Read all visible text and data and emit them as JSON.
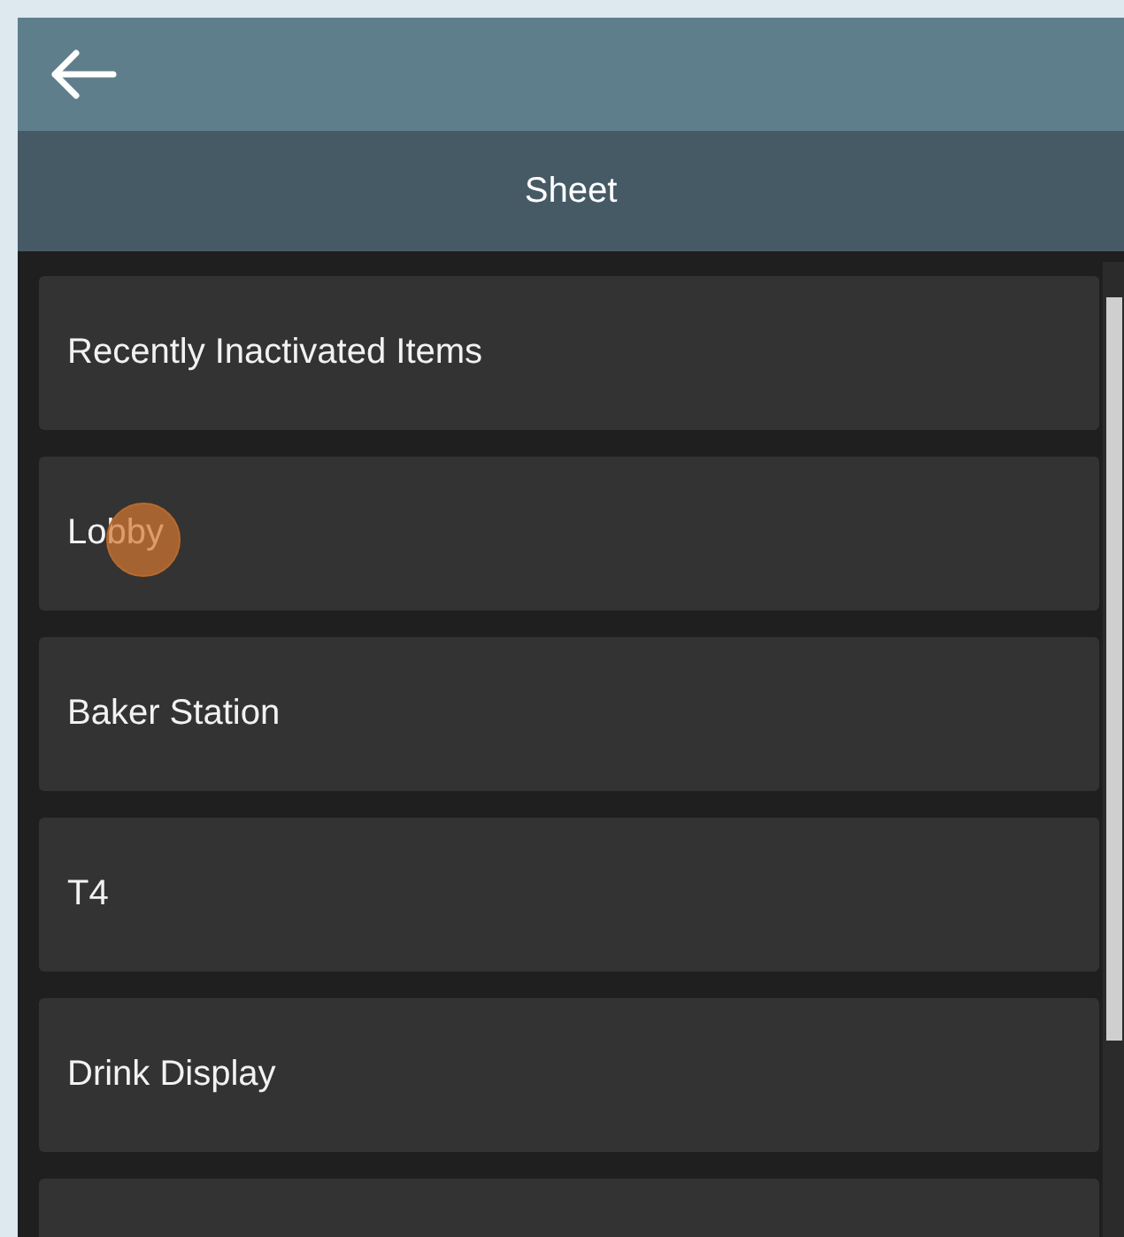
{
  "top_bar": {
    "back": true
  },
  "header": {
    "title": "Sheet"
  },
  "items": [
    {
      "label": "Recently Inactivated Items",
      "touched": false
    },
    {
      "label": "Lobby",
      "touched": true
    },
    {
      "label": "Baker Station",
      "touched": false
    },
    {
      "label": "T4",
      "touched": false
    },
    {
      "label": "Drink Display",
      "touched": false
    }
  ]
}
